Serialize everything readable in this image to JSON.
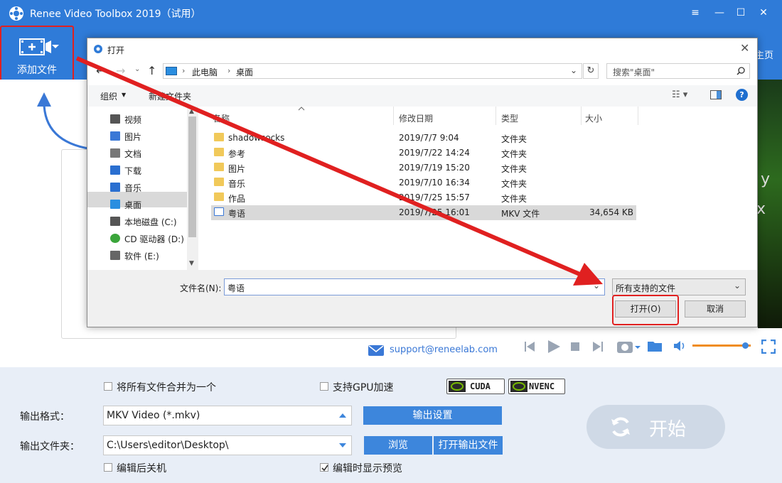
{
  "app": {
    "title": "Renee Video Toolbox 2019（试用）",
    "window_controls": {
      "menu": "≡",
      "minimize": "—",
      "maximize": "☐",
      "close": "✕"
    },
    "toolbar": {
      "add_file_label": "添加文件",
      "home_label": "主页"
    },
    "support_email": "support@reneelab.com",
    "options": {
      "merge_all_label": "将所有文件合并为一个",
      "merge_all_checked": false,
      "gpu_accel_label": "支持GPU加速",
      "gpu_accel_checked": false,
      "cuda_label": "CUDA",
      "nvenc_label": "NVENC",
      "shutdown_label": "编辑后关机",
      "shutdown_checked": false,
      "preview_label": "编辑时显示预览",
      "preview_checked": true
    },
    "output_format": {
      "label": "输出格式：",
      "value": "MKV Video (*.mkv)",
      "settings_button": "输出设置"
    },
    "output_folder": {
      "label": "输出文件夹：",
      "value": "C:\\Users\\editor\\Desktop\\",
      "browse_button": "浏览",
      "open_folder_button": "打开输出文件"
    },
    "start_button": "开始",
    "volume_level": 0.9,
    "preview_text_1": "y",
    "preview_text_2": "x"
  },
  "dialog": {
    "title": "打开",
    "address": {
      "root": "此电脑",
      "folder": "桌面"
    },
    "search_placeholder": "搜索\"桌面\"",
    "commands": {
      "organize": "组织",
      "new_folder": "新建文件夹"
    },
    "nav_items": [
      {
        "label": "视频",
        "icon": "video-icon"
      },
      {
        "label": "图片",
        "icon": "picture-icon"
      },
      {
        "label": "文档",
        "icon": "document-icon"
      },
      {
        "label": "下载",
        "icon": "download-icon"
      },
      {
        "label": "音乐",
        "icon": "music-icon"
      },
      {
        "label": "桌面",
        "icon": "desktop-icon",
        "selected": true
      },
      {
        "label": "本地磁盘 (C:)",
        "icon": "disk-icon"
      },
      {
        "label": "CD 驱动器 (D:)",
        "icon": "cd-drive-icon"
      },
      {
        "label": "软件 (E:)",
        "icon": "drive-icon"
      }
    ],
    "columns": {
      "name": "名称",
      "modified": "修改日期",
      "type": "类型",
      "size": "大小"
    },
    "files": [
      {
        "name": "shadowsocks",
        "modified": "2019/7/7 9:04",
        "type": "文件夹",
        "size": ""
      },
      {
        "name": "参考",
        "modified": "2019/7/22 14:24",
        "type": "文件夹",
        "size": ""
      },
      {
        "name": "图片",
        "modified": "2019/7/19 15:20",
        "type": "文件夹",
        "size": ""
      },
      {
        "name": "音乐",
        "modified": "2019/7/10 16:34",
        "type": "文件夹",
        "size": ""
      },
      {
        "name": "作品",
        "modified": "2019/7/25 15:57",
        "type": "文件夹",
        "size": ""
      },
      {
        "name": "粤语",
        "modified": "2019/7/25 16:01",
        "type": "MKV 文件",
        "size": "34,654 KB",
        "selected": true
      }
    ],
    "filename_label": "文件名(N):",
    "filename_value": "粤语",
    "filetype_value": "所有支持的文件",
    "open_button": "打开(O)",
    "cancel_button": "取消"
  },
  "colors": {
    "brand_blue": "#2f7bd8",
    "highlight_red": "#e02020",
    "selection_gray": "#d9d9d9"
  }
}
